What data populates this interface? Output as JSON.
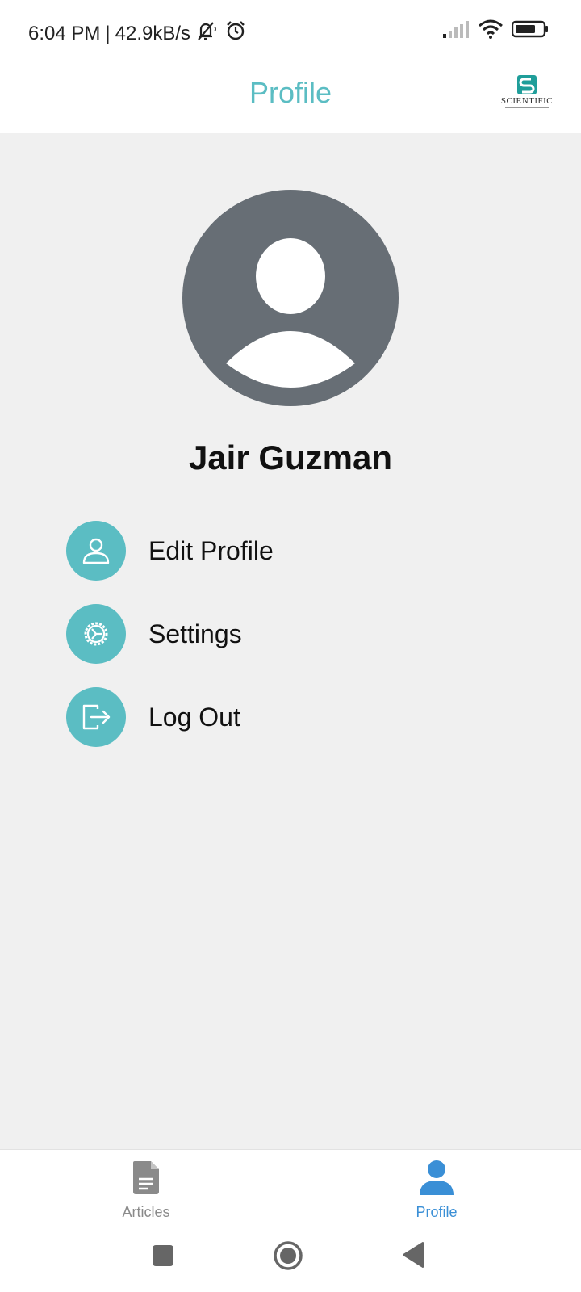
{
  "status_bar": {
    "time": "6:04 PM",
    "separator": "|",
    "network_speed": "42.9kB/s",
    "icons": [
      "notifications-off-icon",
      "alarm-icon",
      "signal-icon",
      "wifi-icon",
      "battery-icon"
    ]
  },
  "header": {
    "title": "Profile",
    "logo_text": "SCIENTIFIC"
  },
  "profile": {
    "name": "Jair Guzman",
    "avatar_icon": "default-avatar-icon"
  },
  "menu": {
    "items": [
      {
        "label": "Edit Profile",
        "icon": "user-icon"
      },
      {
        "label": "Settings",
        "icon": "gear-icon"
      },
      {
        "label": "Log Out",
        "icon": "logout-icon"
      }
    ]
  },
  "bottom_nav": {
    "tabs": [
      {
        "label": "Articles",
        "icon": "document-icon",
        "active": false
      },
      {
        "label": "Profile",
        "icon": "person-icon",
        "active": true
      }
    ]
  },
  "colors": {
    "accent": "#5bbdc3",
    "active_tab": "#3a8fd6",
    "inactive_tab": "#8a8a8a",
    "avatar": "#676e75",
    "background": "#f0f0f0"
  },
  "system_nav": {
    "buttons": [
      "recents-button",
      "home-button",
      "back-button"
    ]
  }
}
